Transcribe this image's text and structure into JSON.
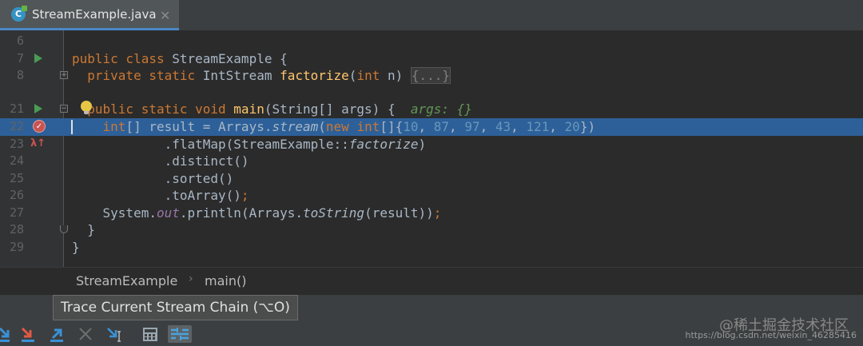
{
  "tab": {
    "label": "StreamExample.java",
    "icon_letter": "C",
    "close": "✕"
  },
  "gutter": {
    "line_numbers": [
      "6",
      "7",
      "8",
      "21",
      "22",
      "23",
      "24",
      "25",
      "26",
      "27",
      "28",
      "29"
    ]
  },
  "code": {
    "line7": {
      "kw": "public class ",
      "name": "StreamExample {"
    },
    "line8": {
      "kw": "private static ",
      "type": "IntStream ",
      "fn": "factorize",
      "paren": "(",
      "kw2": "int ",
      "rest": "n) ",
      "folded": "{...}"
    },
    "line21": {
      "kw": "public static void ",
      "fn": "main",
      "rest": "(String[] args) {  ",
      "hint": "args: {}"
    },
    "line22": {
      "kw": "int",
      "a": "[] result = Arrays.",
      "m": "stream",
      "b": "(",
      "kw2": "new int",
      "c": "[]{",
      "n1": "10",
      "s1": ", ",
      "n2": "87",
      "s2": ", ",
      "n3": "97",
      "s3": ", ",
      "n4": "43",
      "s4": ", ",
      "n5": "121",
      "s5": ", ",
      "n6": "20",
      "d": "})"
    },
    "line23": {
      "a": "        .flatMap(StreamExample::",
      "m": "factorize",
      "b": ")"
    },
    "line24": "        .distinct()",
    "line25": "        .sorted()",
    "line26": {
      "a": "        .toArray()",
      "b": ";"
    },
    "line27": {
      "a": "System.",
      "st": "out",
      "b": ".println(Arrays.",
      "m": "toString",
      "c": "(result))",
      "d": ";"
    },
    "line28": "}",
    "line29": "}"
  },
  "breadcrumb": {
    "items": [
      "StreamExample",
      "main()"
    ],
    "separator": "›"
  },
  "tooltip": {
    "text": "Trace Current Stream Chain (⌥O)"
  },
  "watermark": {
    "text": "@稀土掘金技术社区",
    "url": "https://blog.csdn.net/weixin_46285416"
  },
  "colors": {
    "execution_line": "#2d6099",
    "keyword": "#cc7832",
    "function": "#ffc66d",
    "number": "#6897bb",
    "hint": "#629755",
    "tab_underline": "#4a88c7"
  }
}
